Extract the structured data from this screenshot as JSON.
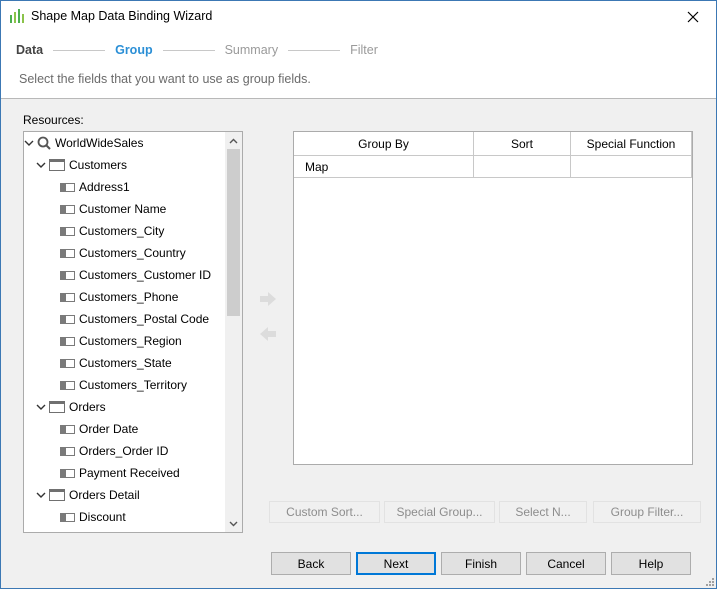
{
  "window": {
    "title": "Shape Map Data Binding Wizard"
  },
  "steps": [
    {
      "label": "Data",
      "state": "done"
    },
    {
      "label": "Group",
      "state": "active"
    },
    {
      "label": "Summary",
      "state": "pending"
    },
    {
      "label": "Filter",
      "state": "pending"
    }
  ],
  "subtitle": "Select the fields that you want to use as group fields.",
  "resources": {
    "label": "Resources:",
    "root": "WorldWideSales",
    "nodes": [
      {
        "type": "table",
        "label": "Customers"
      },
      {
        "type": "field",
        "label": "Address1"
      },
      {
        "type": "field",
        "label": "Customer Name"
      },
      {
        "type": "field",
        "label": "Customers_City"
      },
      {
        "type": "field",
        "label": "Customers_Country"
      },
      {
        "type": "field",
        "label": "Customers_Customer ID"
      },
      {
        "type": "field",
        "label": "Customers_Phone"
      },
      {
        "type": "field",
        "label": "Customers_Postal Code"
      },
      {
        "type": "field",
        "label": "Customers_Region"
      },
      {
        "type": "field",
        "label": "Customers_State"
      },
      {
        "type": "field",
        "label": "Customers_Territory"
      },
      {
        "type": "table",
        "label": "Orders"
      },
      {
        "type": "field",
        "label": "Order Date"
      },
      {
        "type": "field",
        "label": "Orders_Order ID"
      },
      {
        "type": "field",
        "label": "Payment Received"
      },
      {
        "type": "table",
        "label": "Orders Detail"
      },
      {
        "type": "field",
        "label": "Discount"
      }
    ]
  },
  "grid": {
    "columns": [
      "Group By",
      "Sort",
      "Special Function"
    ],
    "rows": [
      [
        "Map",
        "",
        ""
      ]
    ]
  },
  "action_buttons": [
    "Custom Sort...",
    "Special Group...",
    "Select N...",
    "Group Filter..."
  ],
  "footer_buttons": {
    "back": "Back",
    "next": "Next",
    "finish": "Finish",
    "cancel": "Cancel",
    "help": "Help"
  },
  "colors": {
    "active_step": "#2b8fd6",
    "default_button_border": "#0078d7"
  }
}
